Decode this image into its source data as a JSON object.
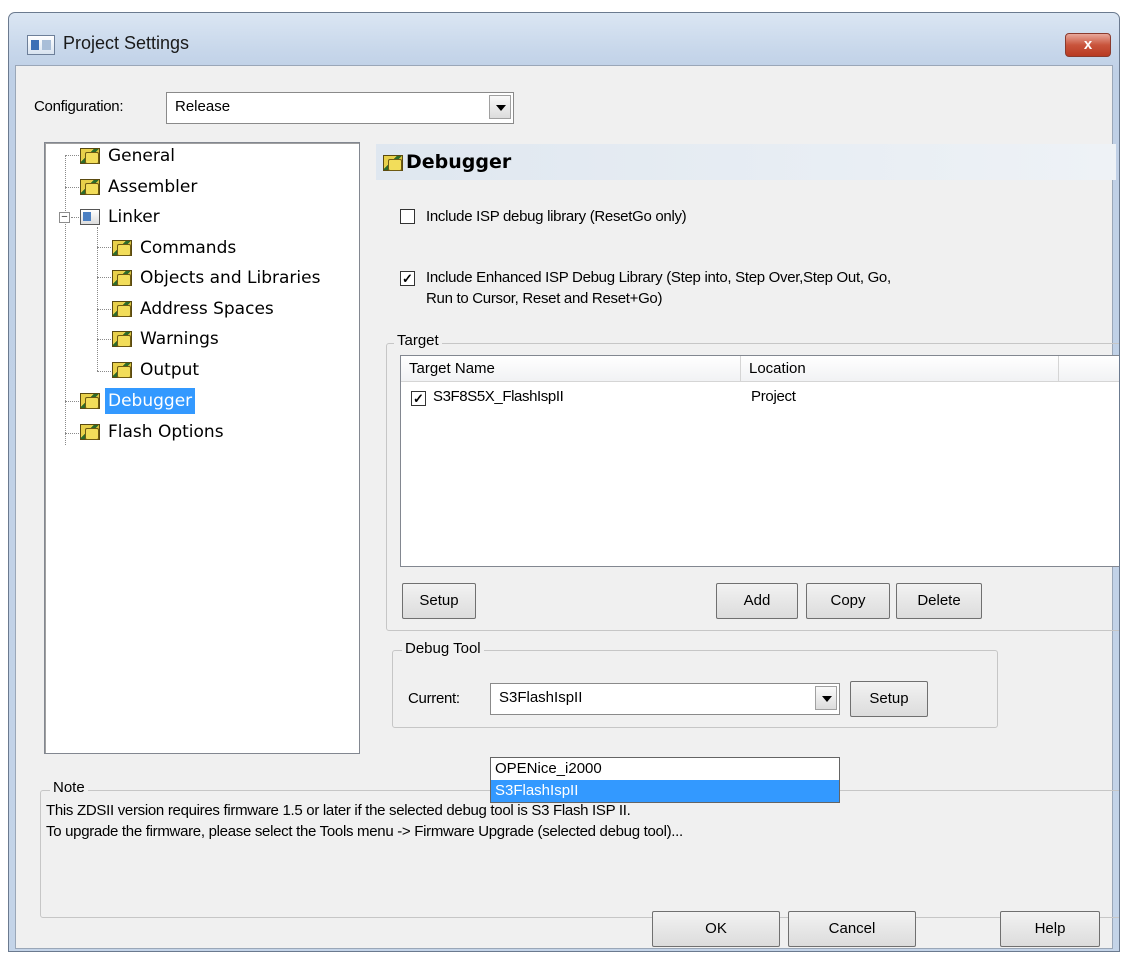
{
  "window": {
    "title": "Project Settings",
    "close_label": "x"
  },
  "configuration": {
    "label": "Configuration:",
    "value": "Release"
  },
  "tree": {
    "items": [
      {
        "label": "General"
      },
      {
        "label": "Assembler"
      },
      {
        "label": "Linker"
      },
      {
        "label": "Commands"
      },
      {
        "label": "Objects and Libraries"
      },
      {
        "label": "Address Spaces"
      },
      {
        "label": "Warnings"
      },
      {
        "label": "Output"
      },
      {
        "label": "Debugger"
      },
      {
        "label": "Flash Options"
      }
    ],
    "selected": "Debugger"
  },
  "section": {
    "title": "Debugger"
  },
  "options": {
    "isp_debug": {
      "label": "Include ISP debug library (ResetGo only)",
      "checked": false
    },
    "enhanced_isp": {
      "label_line1": "Include Enhanced ISP Debug Library (Step into, Step Over,Step Out, Go,",
      "label_line2": "Run to Cursor, Reset and Reset+Go)",
      "checked": true
    }
  },
  "target": {
    "group_label": "Target",
    "columns": [
      "Target Name",
      "Location"
    ],
    "rows": [
      {
        "name": "S3F8S5X_FlashIspII",
        "location": "Project",
        "checked": true
      }
    ],
    "buttons": {
      "setup": "Setup",
      "add": "Add",
      "copy": "Copy",
      "delete": "Delete"
    }
  },
  "debug_tool": {
    "group_label": "Debug Tool",
    "current_label": "Current:",
    "current_value": "S3FlashIspII",
    "setup_label": "Setup",
    "options": [
      "OPENice_i2000",
      "S3FlashIspII"
    ]
  },
  "note": {
    "label": "Note",
    "line1": "This ZDSII version requires firmware 1.5 or later if the selected debug tool is  S3 Flash ISP II.",
    "line2": "To upgrade the firmware, please select the Tools menu -> Firmware Upgrade (selected debug tool)..."
  },
  "footer": {
    "ok": "OK",
    "cancel": "Cancel",
    "help": "Help"
  }
}
